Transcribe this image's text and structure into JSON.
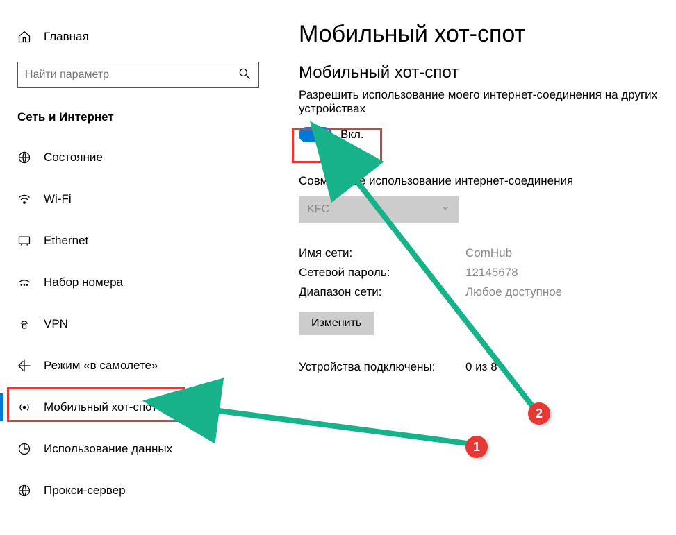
{
  "sidebar": {
    "home": "Главная",
    "search_placeholder": "Найти параметр",
    "section": "Сеть и Интернет",
    "items": [
      {
        "label": "Состояние",
        "icon": "status-icon"
      },
      {
        "label": "Wi-Fi",
        "icon": "wifi-icon"
      },
      {
        "label": "Ethernet",
        "icon": "ethernet-icon"
      },
      {
        "label": "Набор номера",
        "icon": "dialup-icon"
      },
      {
        "label": "VPN",
        "icon": "vpn-icon"
      },
      {
        "label": "Режим «в самолете»",
        "icon": "airplane-icon"
      },
      {
        "label": "Мобильный хот-спот",
        "icon": "hotspot-icon"
      },
      {
        "label": "Использование данных",
        "icon": "datausage-icon"
      },
      {
        "label": "Прокси-сервер",
        "icon": "proxy-icon"
      }
    ]
  },
  "main": {
    "title": "Мобильный хот-спот",
    "subtitle": "Мобильный хот-спот",
    "description": "Разрешить использование моего интернет-соединения на других устройствах",
    "toggle_label": "Вкл.",
    "share_label": "Совместное использование интернет-соединения",
    "dropdown_value": "KFC",
    "network_name_label": "Имя сети:",
    "network_name_value": "ComHub",
    "password_label": "Сетевой пароль:",
    "password_value": "12145678",
    "band_label": "Диапазон сети:",
    "band_value": "Любое доступное",
    "edit_button": "Изменить",
    "devices_label": "Устройства подключены:",
    "devices_value": "0 из 8"
  },
  "annotations": {
    "marker1": "1",
    "marker2": "2"
  }
}
